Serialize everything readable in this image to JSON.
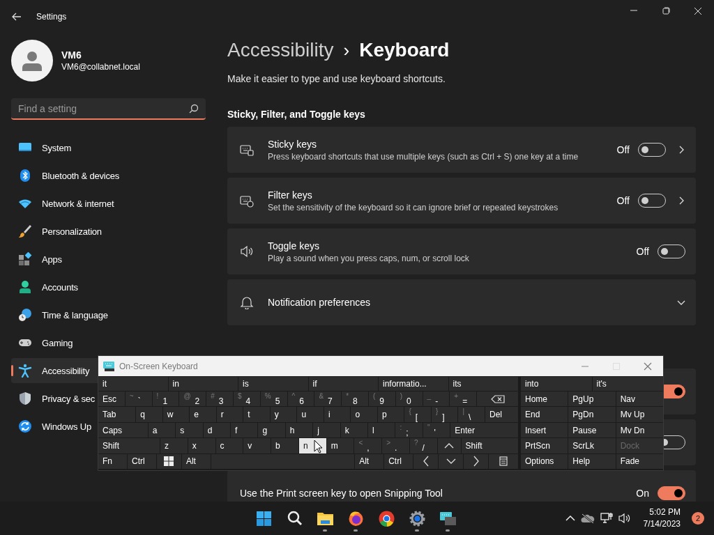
{
  "window": {
    "title": "Settings"
  },
  "user": {
    "name": "VM6",
    "email": "VM6@collabnet.local"
  },
  "search": {
    "placeholder": "Find a setting"
  },
  "sidebar": {
    "items": [
      {
        "label": "System",
        "selected": false
      },
      {
        "label": "Bluetooth & devices",
        "selected": false
      },
      {
        "label": "Network & internet",
        "selected": false
      },
      {
        "label": "Personalization",
        "selected": false
      },
      {
        "label": "Apps",
        "selected": false
      },
      {
        "label": "Accounts",
        "selected": false
      },
      {
        "label": "Time & language",
        "selected": false
      },
      {
        "label": "Gaming",
        "selected": false
      },
      {
        "label": "Accessibility",
        "selected": true
      },
      {
        "label": "Privacy & sec",
        "selected": false
      },
      {
        "label": "Windows Up",
        "selected": false
      }
    ]
  },
  "breadcrumb": {
    "parent": "Accessibility",
    "separator": "›",
    "current": "Keyboard"
  },
  "description": "Make it easier to type and use keyboard shortcuts.",
  "sections": [
    {
      "title": "Sticky, Filter, and Toggle keys",
      "cards": [
        {
          "kind": "link-toggle",
          "title": "Sticky keys",
          "description": "Press keyboard shortcuts that use multiple keys (such as Ctrl + S) one key at a time",
          "state_label": "Off",
          "on": false
        },
        {
          "kind": "link-toggle",
          "title": "Filter keys",
          "description": "Set the sensitivity of the keyboard so it can ignore brief or repeated keystrokes",
          "state_label": "Off",
          "on": false
        },
        {
          "kind": "toggle",
          "title": "Toggle keys",
          "description": "Play a sound when you press caps, num, or scroll lock",
          "state_label": "Off",
          "on": false
        },
        {
          "kind": "expander",
          "title": "Notification preferences",
          "expanded": false
        }
      ]
    },
    {
      "cards": [
        {
          "kind": "toggle",
          "on": true
        },
        {
          "kind": "toggle",
          "on": false
        },
        {
          "kind": "toggle",
          "title": "Use the Print screen key to open Snipping Tool",
          "state_label": "On",
          "on": true
        }
      ]
    }
  ],
  "osk": {
    "title": "On-Screen Keyboard",
    "suggestions": [
      "it",
      "in",
      "is",
      "if",
      "informatio...",
      "its"
    ],
    "suggestions_right": [
      "into",
      "it's"
    ],
    "rows": [
      {
        "keys": [
          {
            "kind": "key",
            "label": "Esc",
            "pressed": false
          },
          {
            "kind": "key",
            "label": "`",
            "shift": "~",
            "pressed": false
          },
          {
            "kind": "key",
            "label": "1",
            "shift": "!",
            "pressed": false
          },
          {
            "kind": "key",
            "label": "2",
            "shift": "@",
            "pressed": false
          },
          {
            "kind": "key",
            "label": "3",
            "shift": "#",
            "pressed": false
          },
          {
            "kind": "key",
            "label": "4",
            "shift": "$",
            "pressed": false
          },
          {
            "kind": "key",
            "label": "5",
            "shift": "%",
            "pressed": false
          },
          {
            "kind": "key",
            "label": "6",
            "shift": "^",
            "pressed": false
          },
          {
            "kind": "key",
            "label": "7",
            "shift": "&",
            "pressed": false
          },
          {
            "kind": "key",
            "label": "8",
            "shift": "*",
            "pressed": false
          },
          {
            "kind": "key",
            "label": "9",
            "shift": "(",
            "pressed": false
          },
          {
            "kind": "key",
            "label": "0",
            "shift": ")",
            "pressed": false
          },
          {
            "kind": "key",
            "label": "-",
            "shift": "_",
            "pressed": false
          },
          {
            "kind": "key",
            "label": "=",
            "shift": "+",
            "pressed": false
          },
          {
            "kind": "backspace",
            "pressed": false
          }
        ]
      },
      {
        "keys": [
          {
            "kind": "tab",
            "label": "Tab",
            "pressed": false
          },
          {
            "kind": "key",
            "label": "q",
            "pressed": false
          },
          {
            "kind": "key",
            "label": "w",
            "pressed": false
          },
          {
            "kind": "key",
            "label": "e",
            "pressed": false
          },
          {
            "kind": "key",
            "label": "r",
            "pressed": false
          },
          {
            "kind": "key",
            "label": "t",
            "pressed": false
          },
          {
            "kind": "key",
            "label": "y",
            "pressed": false
          },
          {
            "kind": "key",
            "label": "u",
            "pressed": false
          },
          {
            "kind": "key",
            "label": "i",
            "pressed": false
          },
          {
            "kind": "key",
            "label": "o",
            "pressed": false
          },
          {
            "kind": "key",
            "label": "p",
            "pressed": false
          },
          {
            "kind": "key",
            "label": "[",
            "shift": "{",
            "pressed": false
          },
          {
            "kind": "key",
            "label": "]",
            "shift": "}",
            "pressed": false
          },
          {
            "kind": "key",
            "label": "\\",
            "shift": "|",
            "pressed": false
          },
          {
            "kind": "del",
            "label": "Del",
            "pressed": false
          }
        ]
      },
      {
        "keys": [
          {
            "kind": "caps",
            "label": "Caps",
            "pressed": false
          },
          {
            "kind": "key",
            "label": "a",
            "pressed": false
          },
          {
            "kind": "key",
            "label": "s",
            "pressed": false
          },
          {
            "kind": "key",
            "label": "d",
            "pressed": false
          },
          {
            "kind": "key",
            "label": "f",
            "pressed": false
          },
          {
            "kind": "key",
            "label": "g",
            "pressed": false
          },
          {
            "kind": "key",
            "label": "h",
            "pressed": false
          },
          {
            "kind": "key",
            "label": "j",
            "pressed": false
          },
          {
            "kind": "key",
            "label": "k",
            "pressed": false
          },
          {
            "kind": "key",
            "label": "l",
            "pressed": false
          },
          {
            "kind": "key",
            "label": ";",
            "shift": ":",
            "pressed": false
          },
          {
            "kind": "key",
            "label": "'",
            "shift": "\"",
            "pressed": false
          },
          {
            "kind": "enter",
            "label": "Enter",
            "pressed": false
          }
        ]
      },
      {
        "keys": [
          {
            "kind": "shift-left",
            "label": "Shift",
            "pressed": false
          },
          {
            "kind": "key",
            "label": "z",
            "pressed": false
          },
          {
            "kind": "key",
            "label": "x",
            "pressed": false
          },
          {
            "kind": "key",
            "label": "c",
            "pressed": false
          },
          {
            "kind": "key",
            "label": "v",
            "pressed": false
          },
          {
            "kind": "key",
            "label": "b",
            "pressed": false
          },
          {
            "kind": "key",
            "label": "n",
            "pressed": true
          },
          {
            "kind": "key",
            "label": "m",
            "pressed": false
          },
          {
            "kind": "key",
            "label": ",",
            "shift": "<",
            "pressed": false
          },
          {
            "kind": "key",
            "label": ".",
            "shift": ">",
            "pressed": false
          },
          {
            "kind": "key",
            "label": "/",
            "shift": "?",
            "pressed": false
          },
          {
            "kind": "arrow-up",
            "pressed": false
          },
          {
            "kind": "shift-right",
            "label": "Shift",
            "pressed": false
          }
        ]
      },
      {
        "keys": [
          {
            "kind": "key",
            "label": "Fn",
            "pressed": false
          },
          {
            "kind": "key",
            "label": "Ctrl",
            "pressed": false
          },
          {
            "kind": "windows",
            "pressed": false
          },
          {
            "kind": "key",
            "label": "Alt",
            "pressed": false
          },
          {
            "kind": "space",
            "pressed": false
          },
          {
            "kind": "key",
            "label": "Alt",
            "pressed": false
          },
          {
            "kind": "key",
            "label": "Ctrl",
            "pressed": false
          },
          {
            "kind": "arrow-left",
            "pressed": false
          },
          {
            "kind": "arrow-down",
            "pressed": false
          },
          {
            "kind": "arrow-right",
            "pressed": false
          },
          {
            "kind": "menu",
            "pressed": false
          }
        ]
      }
    ],
    "nav_keys": [
      {
        "label": "Home",
        "disabled": false
      },
      {
        "label": "PgUp",
        "disabled": false
      },
      {
        "label": "Nav",
        "disabled": false
      },
      {
        "label": "End",
        "disabled": false
      },
      {
        "label": "PgDn",
        "disabled": false
      },
      {
        "label": "Mv Up",
        "disabled": false
      },
      {
        "label": "Insert",
        "disabled": false
      },
      {
        "label": "Pause",
        "disabled": false
      },
      {
        "label": "Mv Dn",
        "disabled": false
      },
      {
        "label": "PrtScn",
        "disabled": false
      },
      {
        "label": "ScrLk",
        "disabled": false
      },
      {
        "label": "Dock",
        "disabled": true
      },
      {
        "label": "Options",
        "disabled": false
      },
      {
        "label": "Help",
        "disabled": false
      },
      {
        "label": "Fade",
        "disabled": false
      }
    ]
  },
  "taskbar": {
    "apps": [
      {
        "running": false
      },
      {
        "running": false
      },
      {
        "running": true
      },
      {
        "running": true
      },
      {
        "running": false
      },
      {
        "running": true
      },
      {
        "running": true
      }
    ],
    "time": "5:02 PM",
    "date": "7/14/2023",
    "notifications": "2"
  }
}
